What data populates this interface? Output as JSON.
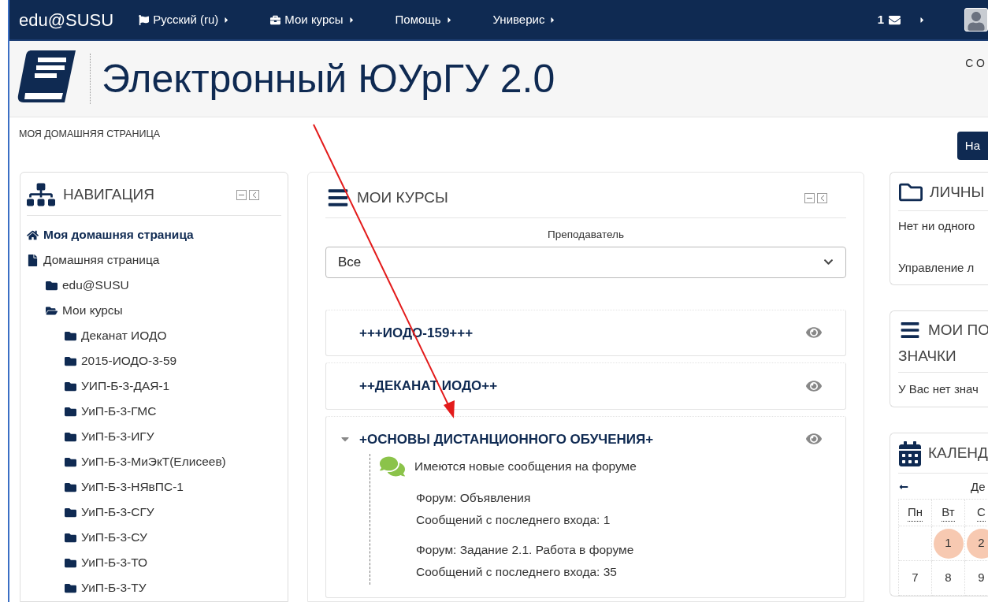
{
  "navbar": {
    "brand": "edu@SUSU",
    "items": [
      {
        "label": "Русский (ru)"
      },
      {
        "label": "Мои курсы"
      },
      {
        "label": "Помощь"
      },
      {
        "label": "Универис"
      }
    ],
    "messages_count": "1"
  },
  "header": {
    "title": "Электронный ЮУрГУ 2.0",
    "top_right": "СО",
    "button": "На"
  },
  "breadcrumb": "МОЯ ДОМАШНЯЯ СТРАНИЦА",
  "navigation": {
    "title": "НАВИГАЦИЯ",
    "items": [
      {
        "label": "Моя домашняя страница",
        "kind": "home"
      },
      {
        "label": "Домашняя страница",
        "kind": "page",
        "children": [
          {
            "label": "edu@SUSU",
            "kind": "folder"
          },
          {
            "label": "Мои курсы",
            "kind": "folder-open",
            "children": [
              {
                "label": "Деканат ИОДО",
                "kind": "folder"
              },
              {
                "label": "2015-ИОДО-3-59",
                "kind": "folder"
              },
              {
                "label": "УИП-Б-3-ДАЯ-1",
                "kind": "folder"
              },
              {
                "label": "УиП-Б-3-ГМС",
                "kind": "folder"
              },
              {
                "label": "УиП-Б-3-ИГУ",
                "kind": "folder"
              },
              {
                "label": "УиП-Б-3-МиЭкТ(Елисеев)",
                "kind": "folder"
              },
              {
                "label": "УиП-Б-3-НЯвПС-1",
                "kind": "folder"
              },
              {
                "label": "УиП-Б-3-СГУ",
                "kind": "folder"
              },
              {
                "label": "УиП-Б-3-СУ",
                "kind": "folder"
              },
              {
                "label": "УиП-Б-3-ТО",
                "kind": "folder"
              },
              {
                "label": "УиП-Б-3-ТУ",
                "kind": "folder"
              }
            ]
          }
        ]
      }
    ]
  },
  "courses": {
    "title": "МОИ КУРСЫ",
    "filter_label": "Преподаватель",
    "filter_value": "Все",
    "items": [
      {
        "title": "+++ИОДО-159+++",
        "expanded": false
      },
      {
        "title": "++ДЕКАНАТ ИОДО++",
        "expanded": false
      },
      {
        "title": "+ОСНОВЫ ДИСТАНЦИОННОГО ОБУЧЕНИЯ+",
        "expanded": true,
        "notice": {
          "heading": "Имеются новые сообщения на форуме",
          "forums": [
            {
              "name": "Форум: Объявления",
              "count": "Сообщений с последнего входа: 1"
            },
            {
              "name": "Форум: Задание 2.1. Работа в форуме",
              "count": "Сообщений с последнего входа: 35"
            }
          ]
        }
      }
    ]
  },
  "right": {
    "files": {
      "title": "ЛИЧНЫ",
      "empty": "Нет ни одного",
      "manage": "Управление л"
    },
    "badges": {
      "title": "МОИ ПО",
      "title_line2": "ЗНАЧКИ",
      "empty": "У Вас нет знач"
    },
    "calendar": {
      "title": "КАЛЕНД",
      "month": "Де",
      "weekdays": [
        "Пн",
        "Вт",
        "С"
      ],
      "weeks": [
        [
          {
            "day": "1",
            "event": true
          },
          {
            "day": "2",
            "event": true
          }
        ],
        [
          {
            "day": "7",
            "event": false
          },
          {
            "day": "8",
            "event": false
          },
          {
            "day": "9",
            "event": false
          }
        ]
      ]
    }
  }
}
